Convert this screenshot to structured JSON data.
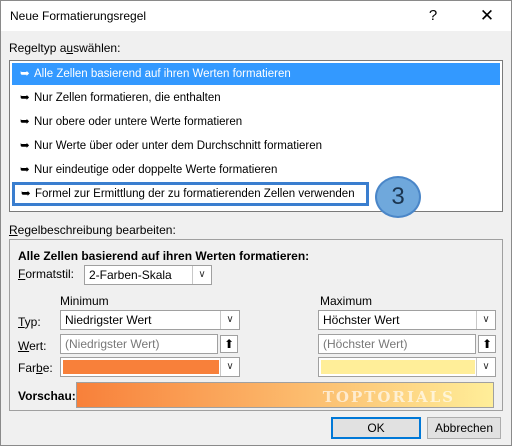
{
  "window": {
    "title": "Neue Formatierungsregel",
    "help_icon": "?",
    "close_icon": "✕"
  },
  "rule_type": {
    "label": "Regeltyp auswählen:",
    "items": [
      {
        "label": "Alle Zellen basierend auf ihren Werten formatieren",
        "selected": true
      },
      {
        "label": "Nur Zellen formatieren, die enthalten"
      },
      {
        "label": "Nur obere oder untere Werte formatieren"
      },
      {
        "label": "Nur Werte über oder unter dem Durchschnitt formatieren"
      },
      {
        "label": "Nur eindeutige oder doppelte Werte formatieren"
      },
      {
        "label": "Formel zur Ermittlung der zu formatierenden Zellen verwenden",
        "highlighted": true
      }
    ],
    "item_arrow": "➥"
  },
  "annotation_badge": "3",
  "description": {
    "label": "Regelbeschreibung bearbeiten:",
    "heading": "Alle Zellen basierend auf ihren Werten formatieren:",
    "format_style_label": "Formatstil:",
    "format_style_value": "2-Farben-Skala",
    "minimum_label": "Minimum",
    "maximum_label": "Maximum",
    "type_label": "Typ:",
    "value_label": "Wert:",
    "color_label": "Farbe:",
    "preview_label": "Vorschau:",
    "min_type": "Niedrigster Wert",
    "max_type": "Höchster Wert",
    "min_value_placeholder": "(Niedrigster Wert)",
    "max_value_placeholder": "(Höchster Wert)",
    "min_color": "#f8803a",
    "max_color": "#ffee99",
    "watermark": "TOPTORIALS"
  },
  "buttons": {
    "ok": "OK",
    "cancel": "Abbrechen"
  },
  "colors": {
    "selection": "#3399ff",
    "highlight_border": "#3a7ecf",
    "badge": "#6fa8dc"
  }
}
